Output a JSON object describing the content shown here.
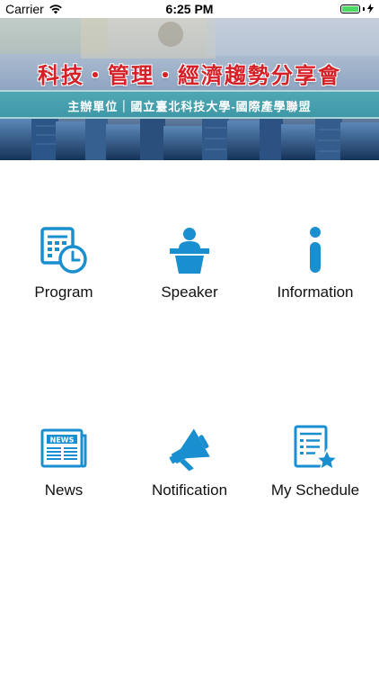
{
  "status_bar": {
    "carrier": "Carrier",
    "time": "6:25 PM"
  },
  "banner": {
    "title": "科技‧管理‧經濟趨勢分享會",
    "subtitle": "主辦單位｜國立臺北科技大學-國際產學聯盟"
  },
  "colors": {
    "accent": "#1a8fd0",
    "title_red": "#d62028",
    "strip_teal": "#4fa7b4"
  },
  "menu": [
    {
      "label": "Program",
      "icon": "calendar-clock-icon"
    },
    {
      "label": "Speaker",
      "icon": "podium-speaker-icon"
    },
    {
      "label": "Information",
      "icon": "info-icon"
    },
    {
      "label": "News",
      "icon": "newspaper-icon"
    },
    {
      "label": "Notification",
      "icon": "megaphone-icon"
    },
    {
      "label": "My Schedule",
      "icon": "document-star-icon"
    }
  ]
}
